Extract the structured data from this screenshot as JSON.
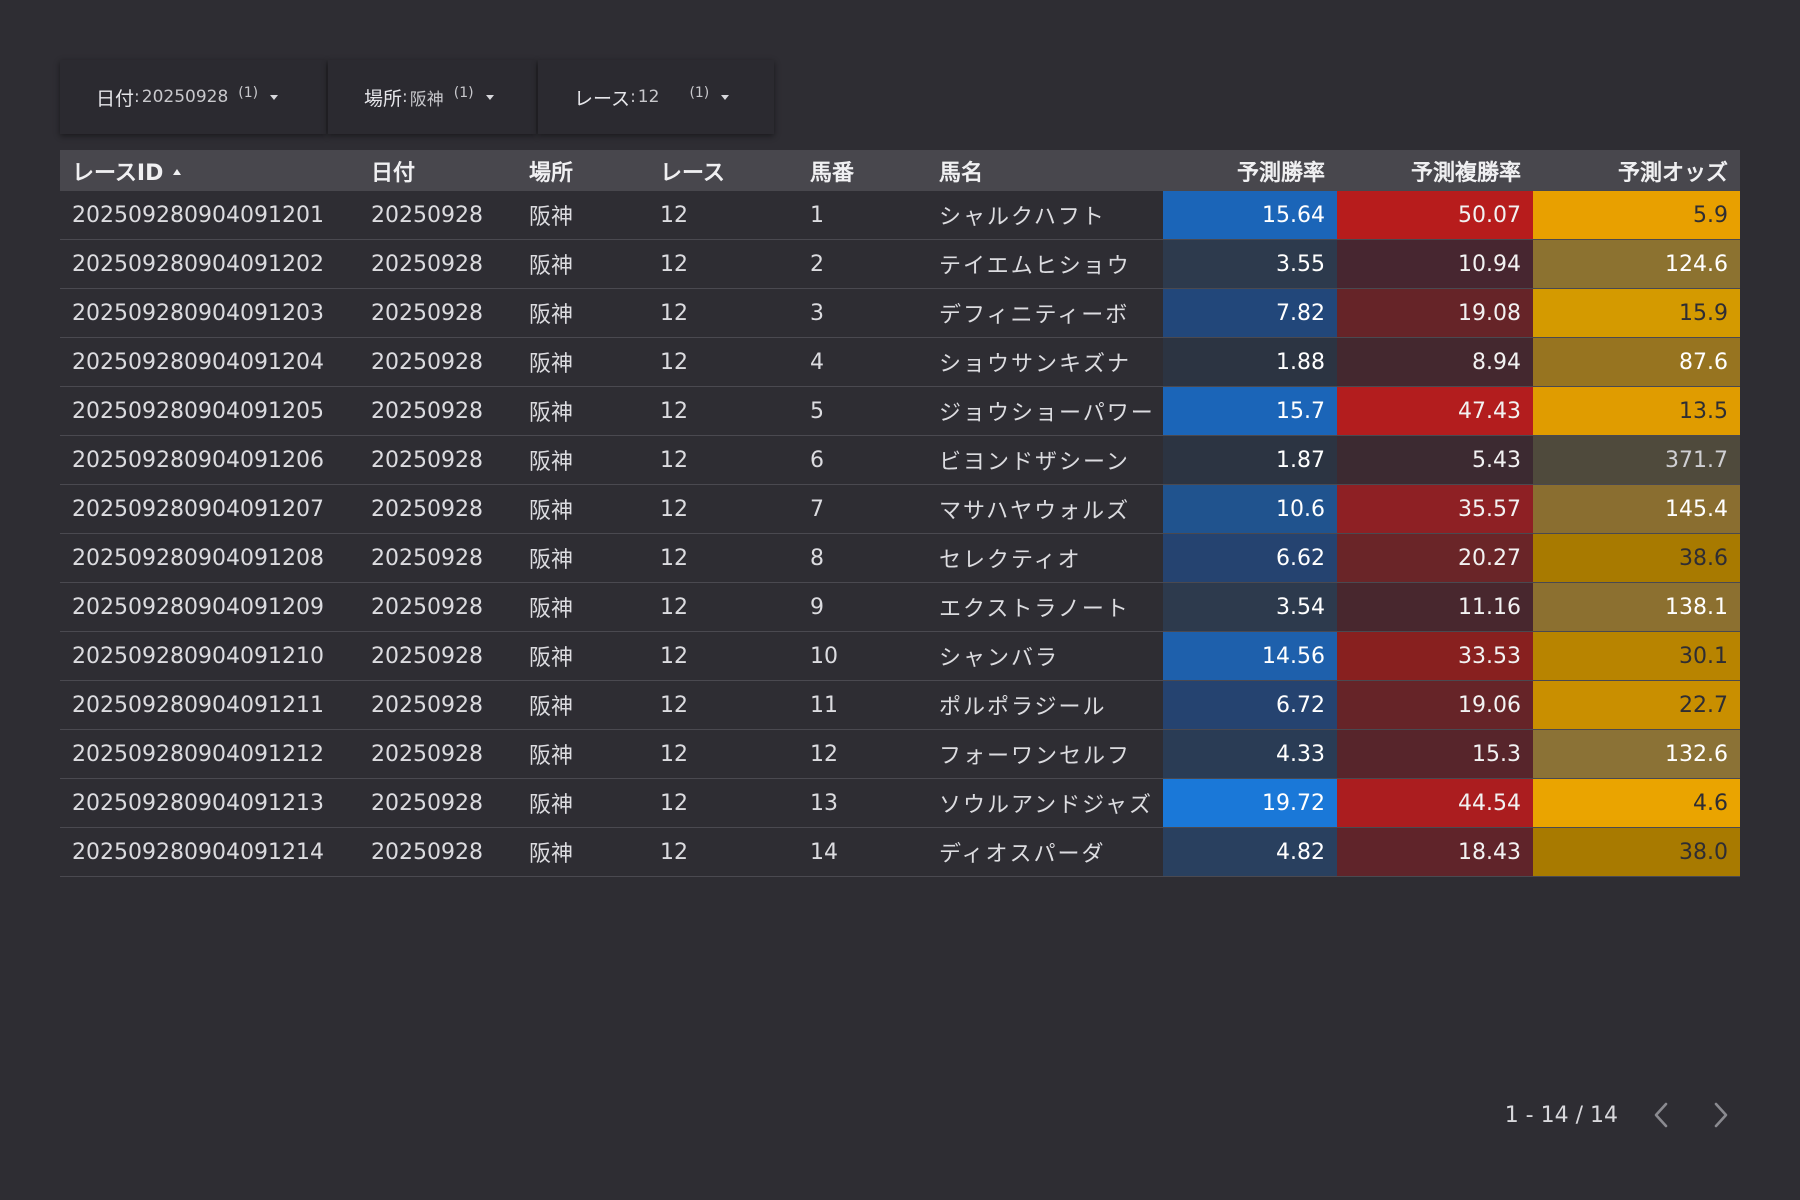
{
  "filters": [
    {
      "label": "日付",
      "sep": ":",
      "value": "20250928",
      "count": "(1)"
    },
    {
      "label": "場所",
      "sep": ":",
      "value": "阪神",
      "count": "(1)"
    },
    {
      "label": "レース",
      "sep": ":",
      "value": "12",
      "count": "(1)"
    }
  ],
  "table": {
    "columns": [
      "レースID",
      "日付",
      "場所",
      "レース",
      "馬番",
      "馬名",
      "予測勝率",
      "予測複勝率",
      "予測オッズ"
    ],
    "sorted_column": "レースID",
    "sort_direction": "ascending",
    "rows": [
      {
        "id": "202509280904091201",
        "date": "20250928",
        "place": "阪神",
        "race": "12",
        "num": "1",
        "name": "シャルクハフト",
        "win": "15.64",
        "place_rate": "50.07",
        "odds": "5.9",
        "win_bg": "#1b65b8",
        "place_bg": "#b71c1c",
        "odds_bg": "#e8a000",
        "odds_fg": "#2e2d33"
      },
      {
        "id": "202509280904091202",
        "date": "20250928",
        "place": "阪神",
        "race": "12",
        "num": "2",
        "name": "テイエムヒショウ",
        "win": "3.55",
        "place_rate": "10.94",
        "odds": "124.6",
        "win_bg": "#2d3a4d",
        "place_bg": "#472630",
        "odds_bg": "#8c7230",
        "odds_fg": "#ffffff"
      },
      {
        "id": "202509280904091203",
        "date": "20250928",
        "place": "阪神",
        "race": "12",
        "num": "3",
        "name": "デフィニティーボ",
        "win": "7.82",
        "place_rate": "19.08",
        "odds": "15.9",
        "win_bg": "#22477a",
        "place_bg": "#662428",
        "odds_bg": "#d49a00",
        "odds_fg": "#2e2d33"
      },
      {
        "id": "202509280904091204",
        "date": "20250928",
        "place": "阪神",
        "race": "12",
        "num": "4",
        "name": "ショウサンキズナ",
        "win": "1.88",
        "place_rate": "8.94",
        "odds": "87.6",
        "win_bg": "#2c3442",
        "place_bg": "#44282f",
        "odds_bg": "#977420",
        "odds_fg": "#ffffff"
      },
      {
        "id": "202509280904091205",
        "date": "20250928",
        "place": "阪神",
        "race": "12",
        "num": "5",
        "name": "ジョウショーパワー",
        "win": "15.7",
        "place_rate": "47.43",
        "odds": "13.5",
        "win_bg": "#1b65b8",
        "place_bg": "#b31d1e",
        "odds_bg": "#e09c00",
        "odds_fg": "#2e2d33"
      },
      {
        "id": "202509280904091206",
        "date": "20250928",
        "place": "阪神",
        "race": "12",
        "num": "6",
        "name": "ビヨンドザシーン",
        "win": "1.87",
        "place_rate": "5.43",
        "odds": "371.7",
        "win_bg": "#2c3442",
        "place_bg": "#3c2a31",
        "odds_bg": "#4f4a3c",
        "odds_fg": "#d0d0d4"
      },
      {
        "id": "202509280904091207",
        "date": "20250928",
        "place": "阪神",
        "race": "12",
        "num": "7",
        "name": "マサハヤウォルズ",
        "win": "10.6",
        "place_rate": "35.57",
        "odds": "145.4",
        "win_bg": "#20538e",
        "place_bg": "#8e2024",
        "odds_bg": "#8a6e30",
        "odds_fg": "#ffffff"
      },
      {
        "id": "202509280904091208",
        "date": "20250928",
        "place": "阪神",
        "race": "12",
        "num": "8",
        "name": "セレクティオ",
        "win": "6.62",
        "place_rate": "20.27",
        "odds": "38.6",
        "win_bg": "#254370",
        "place_bg": "#6a2528",
        "odds_bg": "#a87a00",
        "odds_fg": "#2e2d33"
      },
      {
        "id": "202509280904091209",
        "date": "20250928",
        "place": "阪神",
        "race": "12",
        "num": "9",
        "name": "エクストラノート",
        "win": "3.54",
        "place_rate": "11.16",
        "odds": "138.1",
        "win_bg": "#2d3a4d",
        "place_bg": "#48272e",
        "odds_bg": "#8c7030",
        "odds_fg": "#ffffff"
      },
      {
        "id": "202509280904091210",
        "date": "20250928",
        "place": "阪神",
        "race": "12",
        "num": "10",
        "name": "シャンバラ",
        "win": "14.56",
        "place_rate": "33.53",
        "odds": "30.1",
        "win_bg": "#1e60ac",
        "place_bg": "#88201f",
        "odds_bg": "#b88400",
        "odds_fg": "#2e2d33"
      },
      {
        "id": "202509280904091211",
        "date": "20250928",
        "place": "阪神",
        "race": "12",
        "num": "11",
        "name": "ポルポラジール",
        "win": "6.72",
        "place_rate": "19.06",
        "odds": "22.7",
        "win_bg": "#254370",
        "place_bg": "#662428",
        "odds_bg": "#c98f00",
        "odds_fg": "#2e2d33"
      },
      {
        "id": "202509280904091212",
        "date": "20250928",
        "place": "阪神",
        "race": "12",
        "num": "12",
        "name": "フォーワンセルフ",
        "win": "4.33",
        "place_rate": "15.3",
        "odds": "132.6",
        "win_bg": "#2a3c55",
        "place_bg": "#57252b",
        "odds_bg": "#8b7236",
        "odds_fg": "#ffffff"
      },
      {
        "id": "202509280904091213",
        "date": "20250928",
        "place": "阪神",
        "race": "12",
        "num": "13",
        "name": "ソウルアンドジャズ",
        "win": "19.72",
        "place_rate": "44.54",
        "odds": "4.6",
        "win_bg": "#1a78d8",
        "place_bg": "#ab1d1f",
        "odds_bg": "#eaa400",
        "odds_fg": "#2e2d33"
      },
      {
        "id": "202509280904091214",
        "date": "20250928",
        "place": "阪神",
        "race": "12",
        "num": "14",
        "name": "ディオスパーダ",
        "win": "4.82",
        "place_rate": "18.43",
        "odds": "38.0",
        "win_bg": "#29405f",
        "place_bg": "#60242a",
        "odds_bg": "#a87a00",
        "odds_fg": "#2e2d33"
      }
    ]
  },
  "pagination": {
    "range_text": "1 - 14 / 14",
    "prev_icon": "chevron-left-icon",
    "next_icon": "chevron-right-icon"
  },
  "colors": {
    "background": "#2e2d33",
    "header_bg": "#48474d",
    "win_scale": "#1a78d8",
    "place_scale": "#b71c1c",
    "odds_scale": "#e8a000"
  }
}
